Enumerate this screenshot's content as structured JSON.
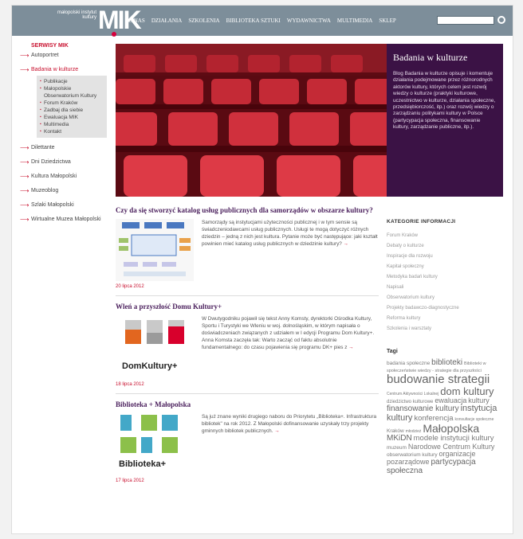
{
  "header": {
    "logo_small": "małopolski instytut kultury",
    "logo": "MIK",
    "nav": [
      "O NAS",
      "DZIAŁANIA",
      "SZKOLENIA",
      "BIBLIOTEKA SZTUKI",
      "WYDAWNICTWA",
      "MULTIMEDIA",
      "SKLEP"
    ],
    "search_placeholder": ""
  },
  "sidebar": {
    "title": "SERWISY MIK",
    "items_top": [
      {
        "label": "Autoportret"
      },
      {
        "label": "Badania w kulturze"
      }
    ],
    "sub_items": [
      "Publikacje",
      "Małopolskie Obserwatorium Kultury",
      "Forum Kraków",
      "Zadbaj dla siebie",
      "Ewaluacja MIK",
      "Multimedia",
      "Kontakt"
    ],
    "items_bottom": [
      {
        "label": "Dilettante"
      },
      {
        "label": "Dni Dziedzictwa"
      },
      {
        "label": "Kultura Małopolski"
      },
      {
        "label": "Muzeoblog"
      },
      {
        "label": "Szlaki Małopolski"
      },
      {
        "label": "Wirtualne Muzea Małopolski"
      }
    ]
  },
  "hero": {
    "title": "Badania w kulturze",
    "text": "Blog Badania w kulturze opisuje i komentuje działania podejmowane przez różnorodnych aktorów kultury, których celem jest rozwój wiedzy o kulturze (praktyki kulturowe, uczestnictwo w kulturze, działania społeczne, przedsiębiorczość, itp.) oraz rozwój wiedzy o zarządzaniu politykami kultury w Polsce (partycypacja społeczna, finansowanie kultury, zarządzanie publiczne, itp.)."
  },
  "articles": [
    {
      "title": "Czy da się stworzyć katalog usług publicznych dla samorządów w obszarze kultury?",
      "text": "Samorządy są instytucjami użyteczności publicznej i w tym sensie są świadczeniodawcami usług publicznych. Usługi te mogą dotyczyć różnych dziedzin – jedną z nich jest kultura. Pytanie może być następujące: jaki kształt powinien mieć katalog usług publicznych w dziedzinie kultury?",
      "more": "→",
      "date": "20 lipca 2012"
    },
    {
      "title": "Wleń a przyszłość Domu Kultury+",
      "text": "W Dwutygodniku pojawił się tekst Anny Komsty, dyrektorki Ośrodka Kultury, Sportu i Turystyki we Wleniu w woj. dolnośląskim, w którym napisała o doświadczeniach związanych z udziałem w I edycji Programu Dom Kultury+. Anna Komsta zaczęła tak: Warto zacząć od faktu absolutnie fundamentalnego: do czasu pojawienia się programu DK+ pies z",
      "more": "→",
      "date": "18 lipca 2012",
      "logo": "DomKultury+"
    },
    {
      "title": "Biblioteka + Małopolska",
      "text": "Są już znane wyniki drugiego naboru do Priorytetu „Biblioteka+. Infrastruktura bibliotek\" na rok 2012. Z Małopolski dofinansowanie uzyskały trzy projekty gminnych bibliotek publicznych.",
      "more": "→",
      "date": "17 lipca 2012",
      "logo": "Biblioteka+"
    }
  ],
  "categories": {
    "title": "KATEGORIE INFORMACJI",
    "items": [
      "Forum Kraków",
      "Debaty o kulturze",
      "Inspiracje dla rozwoju",
      "Kapitał społeczny",
      "Metodyka badań kultury",
      "Napisali",
      "Obserwatorium kultury",
      "Projekty badawczo-diagnostyczne",
      "Reforma kultury",
      "Szkolenia i warsztaty"
    ]
  },
  "tags": {
    "title": "Tagi",
    "items": [
      {
        "t": "badania społeczne",
        "s": 6.5
      },
      {
        "t": "biblioteki",
        "s": 10
      },
      {
        "t": "Biblioteki w społeczeństwie wiedzy - strategie dla przyszłości",
        "s": 5.5
      },
      {
        "t": "budowanie strategii",
        "s": 15
      },
      {
        "t": "Centrum Aktywności Lokalnej",
        "s": 5
      },
      {
        "t": "dom kultury",
        "s": 13
      },
      {
        "t": "dziedzictwo kulturowe",
        "s": 6
      },
      {
        "t": "ewaluacja",
        "s": 9
      },
      {
        "t": "kultury",
        "s": 9
      },
      {
        "t": "finansowanie kultury",
        "s": 10
      },
      {
        "t": "instytucja kultury",
        "s": 11
      },
      {
        "t": "konferencja",
        "s": 9.5
      },
      {
        "t": "konsultacje społeczne",
        "s": 5
      },
      {
        "t": "Kraków",
        "s": 6.5
      },
      {
        "t": "młodzież",
        "s": 5
      },
      {
        "t": "Małopolska",
        "s": 14
      },
      {
        "t": "MKiDN",
        "s": 10
      },
      {
        "t": "modele instytucji kultury",
        "s": 9.5
      },
      {
        "t": "muzeum",
        "s": 6.5
      },
      {
        "t": "Narodowe Centrum Kultury",
        "s": 9
      },
      {
        "t": "obserwatorium kultury",
        "s": 6.5
      },
      {
        "t": "organizacje pozarządowe",
        "s": 9
      },
      {
        "t": "partycypacja społeczna",
        "s": 10
      }
    ]
  }
}
